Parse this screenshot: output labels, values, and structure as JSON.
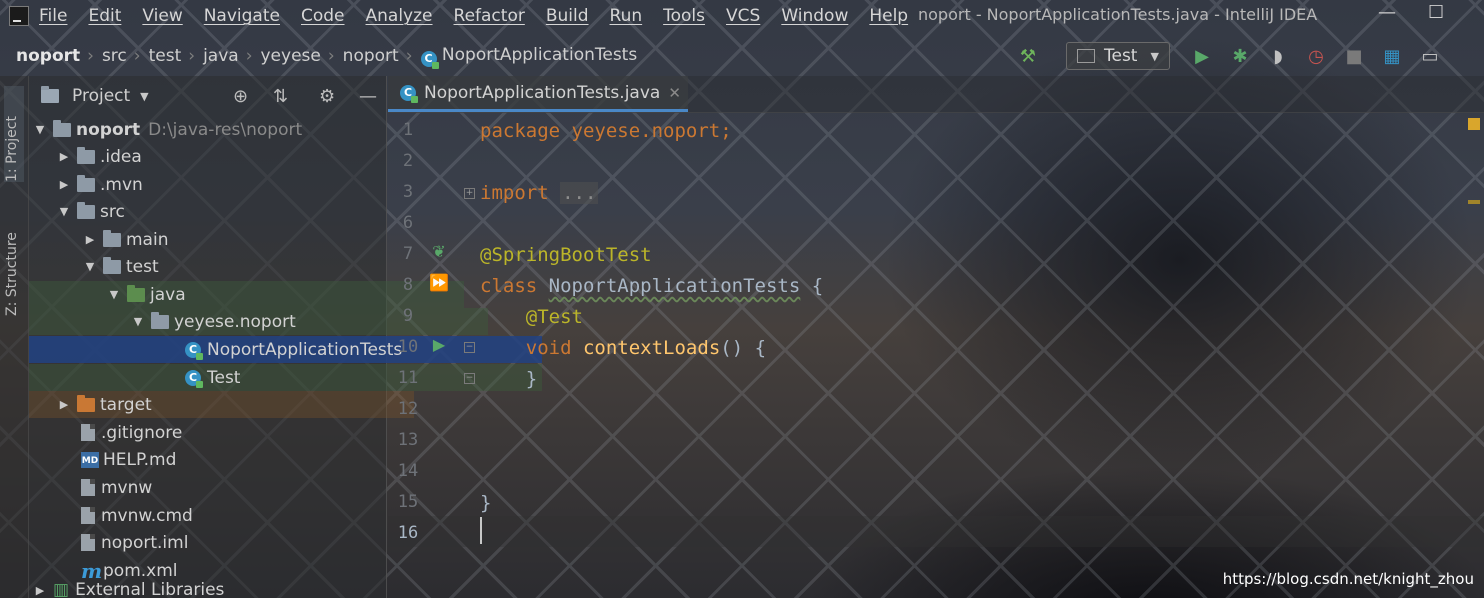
{
  "window": {
    "title": "noport - NoportApplicationTests.java - IntelliJ IDEA",
    "minimize_glyph": "—",
    "maximize_glyph": "☐"
  },
  "menu": [
    "File",
    "Edit",
    "View",
    "Navigate",
    "Code",
    "Analyze",
    "Refactor",
    "Build",
    "Run",
    "Tools",
    "VCS",
    "Window",
    "Help"
  ],
  "breadcrumb": [
    "noport",
    "src",
    "test",
    "java",
    "yeyese",
    "noport",
    "NoportApplicationTests"
  ],
  "toolbar": {
    "run_config": "Test"
  },
  "tool_strip": {
    "project_tab": "1: Project",
    "structure_tab": "Z: Structure"
  },
  "project_panel": {
    "title": "Project",
    "root_name": "noport",
    "root_path": "D:\\java-res\\noport",
    "items": [
      ".idea",
      ".mvn",
      "src",
      "main",
      "test",
      "java",
      "yeyese.noport",
      "NoportApplicationTests",
      "Test",
      "target",
      ".gitignore",
      "HELP.md",
      "mvnw",
      "mvnw.cmd",
      "noport.iml",
      "pom.xml",
      "External Libraries"
    ]
  },
  "editor": {
    "tab_name": "NoportApplicationTests.java",
    "line_numbers": [
      "1",
      "2",
      "3",
      "6",
      "7",
      "8",
      "9",
      "10",
      "11",
      "12",
      "13",
      "14",
      "15",
      "16"
    ],
    "code": {
      "l1_kw": "package",
      "l1_rest": " yeyese.noport;",
      "l3_kw": "import",
      "l3_fold": "...",
      "l7_ann": "@SpringBootTest",
      "l8_kw": "class",
      "l8_cls": "NoportApplicationTests",
      "l8_rest": " {",
      "l9_ann": "@Test",
      "l10_kw": "void",
      "l10_fn": "contextLoads",
      "l10_rest": "() {",
      "l11": "}",
      "l15": "}"
    }
  },
  "watermark": "https://blog.csdn.net/knight_zhou",
  "colors": {
    "keyword": "#cc7832",
    "annotation": "#bbb529",
    "function": "#ffc66d",
    "selection": "#214283"
  }
}
